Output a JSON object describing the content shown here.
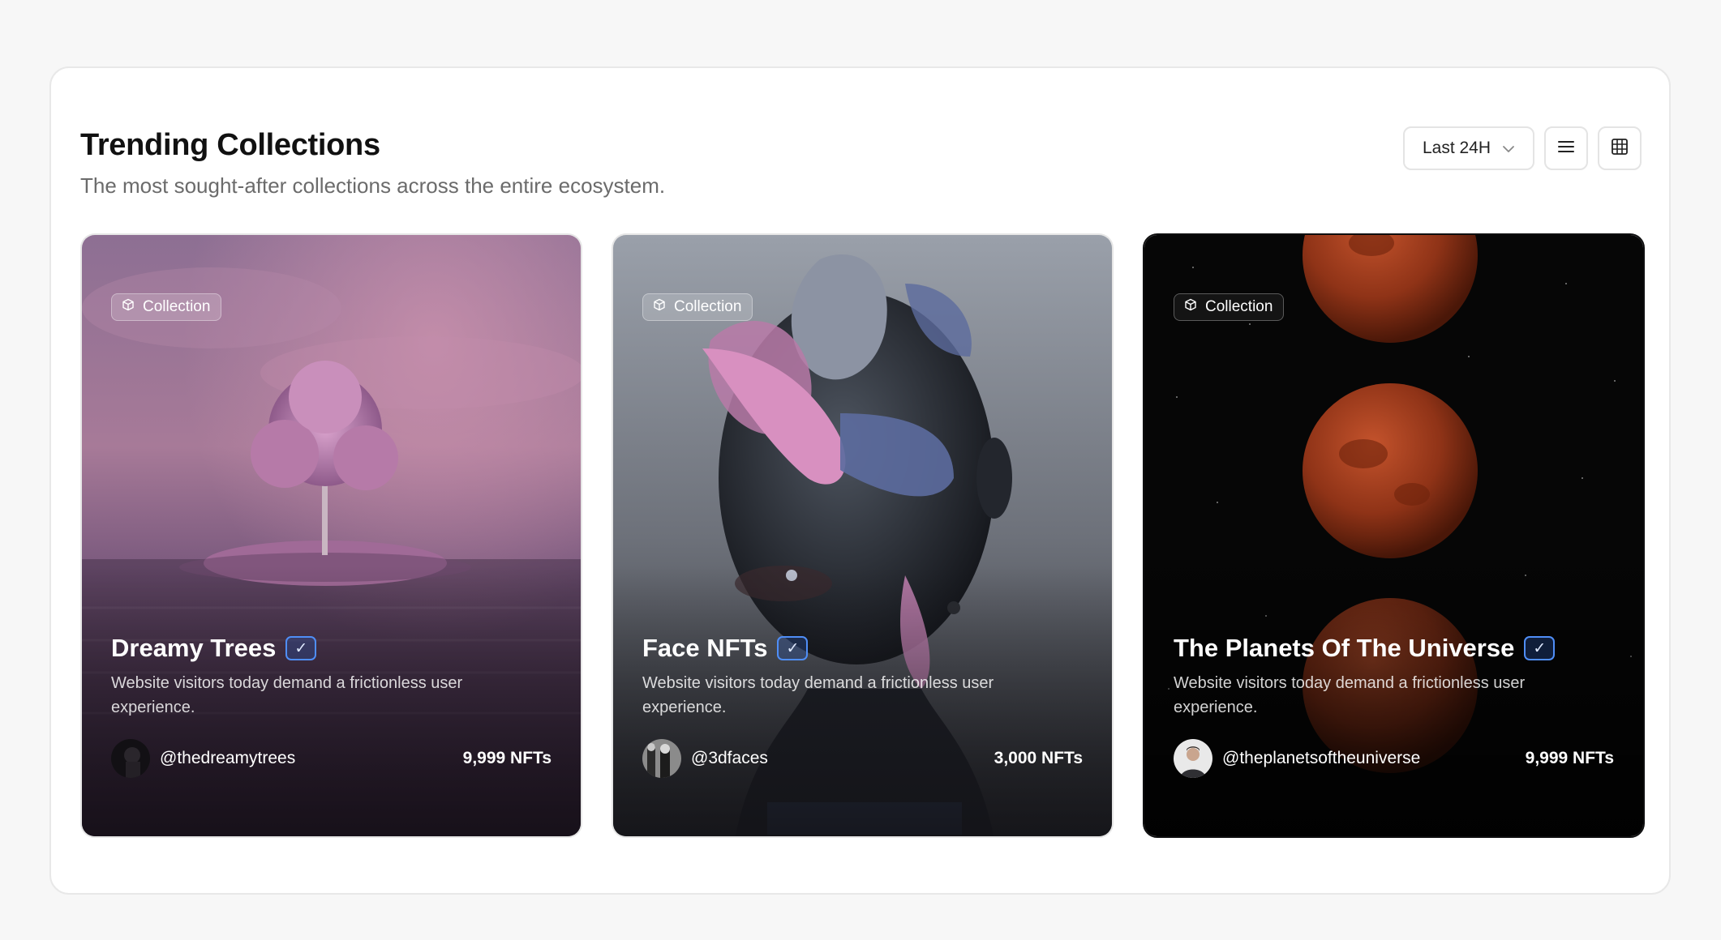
{
  "header": {
    "title": "Trending Collections",
    "subtitle": "The most sought-after collections across the entire ecosystem."
  },
  "controls": {
    "period_label": "Last 24H",
    "period_icon": "chevron-down-icon",
    "list_view_icon": "list-icon",
    "grid_view_icon": "grid-icon"
  },
  "cards": [
    {
      "badge": "Collection",
      "badge_icon": "cube-icon",
      "name": "Dreamy Trees",
      "verified_icon": "check-icon",
      "description": "Website visitors today demand a frictionless user experience.",
      "owner": "@thedreamytrees",
      "count": "9,999 NFTs"
    },
    {
      "badge": "Collection",
      "badge_icon": "cube-icon",
      "name": "Face NFTs",
      "verified_icon": "check-icon",
      "description": "Website visitors today demand a frictionless user experience.",
      "owner": "@3dfaces",
      "count": "3,000 NFTs"
    },
    {
      "badge": "Collection",
      "badge_icon": "cube-icon",
      "name": "The Planets Of The Universe",
      "verified_icon": "check-icon",
      "description": "Website visitors today demand a frictionless user experience.",
      "owner": "@theplanetsoftheuniverse",
      "count": "9,999 NFTs"
    }
  ],
  "colors": {
    "accent": "#4f8ef7",
    "panel_border": "#e8e8e8",
    "muted_text": "#6b6b6b"
  }
}
